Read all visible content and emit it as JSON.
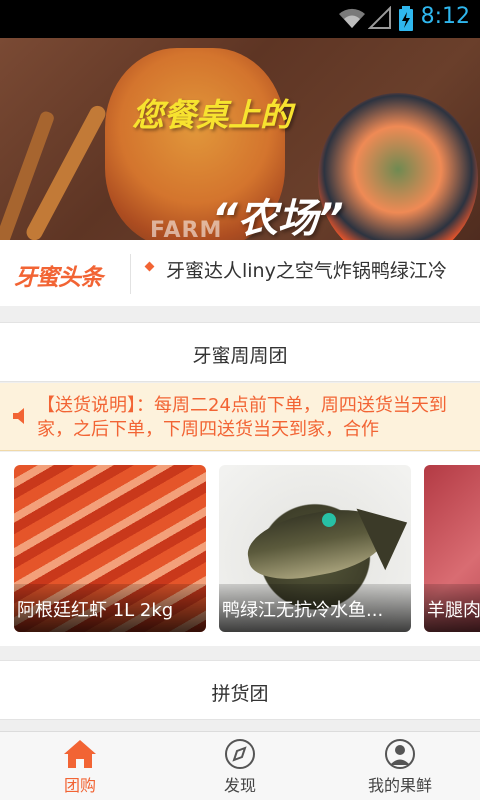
{
  "status_bar": {
    "time": "8:12"
  },
  "banner": {
    "headline": "您餐桌上的",
    "subtitle_en": "FARM",
    "subtitle_cn": "“农场”",
    "slides": 3,
    "active_slide": 2
  },
  "ticker": {
    "logo": "牙蜜头条",
    "text": "牙蜜达人liny之空气炸锅鸭绿江冷"
  },
  "section_weekly": {
    "title": "牙蜜周周团"
  },
  "notice": {
    "text": "【送货说明】：每周二24点前下单，周四送货当天到家，之后下单，下周四送货当天到家，合作"
  },
  "products": [
    {
      "name": "阿根廷红虾 1L 2kg"
    },
    {
      "name": "鸭绿江无抗冷水鱼..."
    },
    {
      "name": "羊腿肉"
    }
  ],
  "section_group": {
    "title": "拼货团"
  },
  "bottom_nav": [
    {
      "label": "团购",
      "icon": "home-icon",
      "active": true
    },
    {
      "label": "发现",
      "icon": "compass-icon",
      "active": false
    },
    {
      "label": "我的果鲜",
      "icon": "user-icon",
      "active": false
    }
  ],
  "colors": {
    "accent": "#f26434",
    "notice_bg": "#fdf2dc",
    "status_time": "#2fb7ee"
  }
}
